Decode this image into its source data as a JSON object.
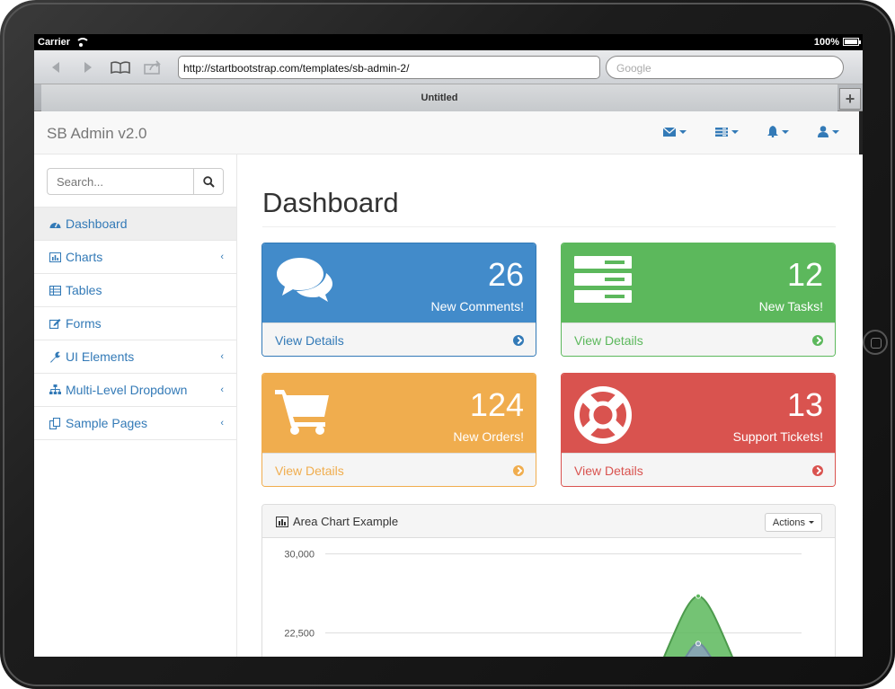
{
  "device": {
    "carrier": "Carrier",
    "battery": "100%"
  },
  "browser": {
    "url": "http://startbootstrap.com/templates/sb-admin-2/",
    "search_placeholder": "Google",
    "tab_title": "Untitled",
    "new_tab": "+"
  },
  "navbar": {
    "brand": "SB Admin v2.0"
  },
  "sidebar": {
    "search_placeholder": "Search...",
    "items": [
      {
        "label": "Dashboard",
        "icon": "dashboard-icon",
        "active": true
      },
      {
        "label": "Charts",
        "icon": "bar-chart-icon",
        "has_submenu": true
      },
      {
        "label": "Tables",
        "icon": "table-icon"
      },
      {
        "label": "Forms",
        "icon": "edit-icon"
      },
      {
        "label": "UI Elements",
        "icon": "wrench-icon",
        "has_submenu": true
      },
      {
        "label": "Multi-Level Dropdown",
        "icon": "sitemap-icon",
        "has_submenu": true
      },
      {
        "label": "Sample Pages",
        "icon": "files-icon",
        "has_submenu": true
      }
    ]
  },
  "main": {
    "title": "Dashboard",
    "panels": [
      {
        "value": "26",
        "label": "New Comments!",
        "link": "View Details",
        "color": "#428bca"
      },
      {
        "value": "12",
        "label": "New Tasks!",
        "link": "View Details",
        "color": "#5cb85c"
      },
      {
        "value": "124",
        "label": "New Orders!",
        "link": "View Details",
        "color": "#f0ad4e"
      },
      {
        "value": "13",
        "label": "Support Tickets!",
        "link": "View Details",
        "color": "#d9534f"
      }
    ],
    "chart_panel": {
      "title": "Area Chart Example",
      "actions_label": "Actions"
    }
  },
  "chart_data": {
    "type": "area",
    "title": "Area Chart Example",
    "y_ticks": [
      "30,000",
      "22,500"
    ],
    "ylim_visible": [
      20000,
      31500
    ],
    "series": [
      {
        "color": "#5cb85c",
        "peak": 26000
      },
      {
        "color": "#8aa3b8",
        "peak": 21500
      }
    ]
  }
}
